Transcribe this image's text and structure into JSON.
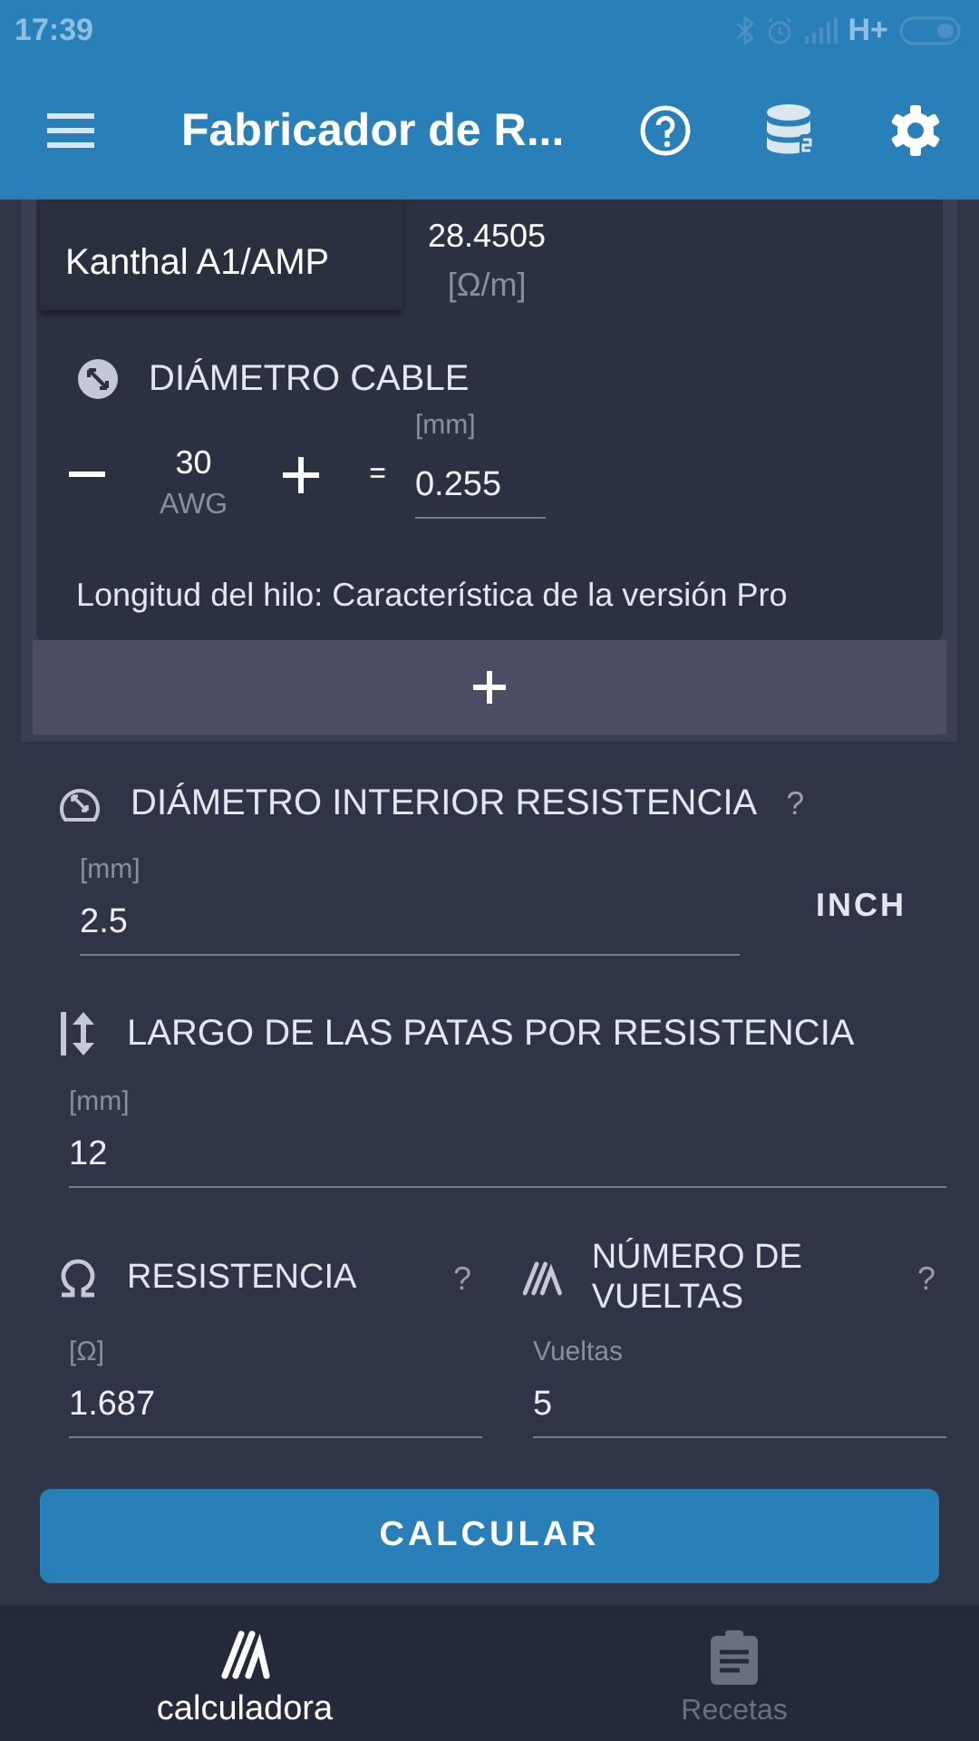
{
  "status_bar": {
    "time": "17:39",
    "network": "H+"
  },
  "app_bar": {
    "title": "Fabricador de R..."
  },
  "wire": {
    "material": "Kanthal A1/AMP",
    "resistivity": "28.4505",
    "resistivity_unit": "[Ω/m]",
    "diameter_title": "DIÁMETRO CABLE",
    "gauge": "30",
    "gauge_unit": "AWG",
    "equals": "=",
    "diameter_unit": "[mm]",
    "diameter": "0.255",
    "length_note": "Longitud del hilo: Característica de la versión Pro"
  },
  "inner_diameter": {
    "title": "DIÁMETRO INTERIOR RESISTENCIA",
    "help": "?",
    "unit": "[mm]",
    "value": "2.5",
    "unit_toggle": "INCH"
  },
  "leg_length": {
    "title": "LARGO DE LAS PATAS POR RESISTENCIA",
    "unit": "[mm]",
    "value": "12"
  },
  "resistance": {
    "title": "RESISTENCIA",
    "help": "?",
    "unit": "[Ω]",
    "value": "1.687"
  },
  "turns": {
    "title": "NÚMERO DE VUELTAS",
    "help": "?",
    "unit": "Vueltas",
    "value": "5"
  },
  "calculate_button": "CALCULAR",
  "bottom_nav": [
    {
      "label": "calculadora",
      "kind": "calculator",
      "selected": true
    },
    {
      "label": "Recetas",
      "kind": "recipes",
      "selected": false
    }
  ]
}
